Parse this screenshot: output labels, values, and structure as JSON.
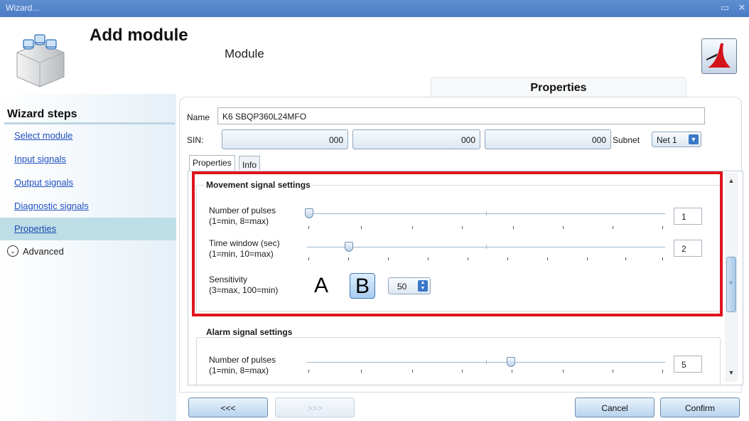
{
  "window": {
    "title": "Wizard...",
    "restore_icon": "restore-icon",
    "close_icon": "close-icon"
  },
  "header": {
    "title": "Add module",
    "subtitle": "Module",
    "app_icon": "module-blocks-icon",
    "logo_icon": "app-logo-icon"
  },
  "tabs": {
    "main": "Properties"
  },
  "sidebar": {
    "heading": "Wizard steps",
    "items": [
      {
        "label": "Select module",
        "active": false
      },
      {
        "label": "Input signals",
        "active": false
      },
      {
        "label": "Output signals",
        "active": false
      },
      {
        "label": "Diagnostic signals",
        "active": false
      },
      {
        "label": "Properties",
        "active": true
      }
    ],
    "advanced_label": "Advanced"
  },
  "form": {
    "name_label": "Name",
    "name_value": "K6 SBQP360L24MFO",
    "sin_label": "SIN:",
    "sin_values": [
      "000",
      "000",
      "000"
    ],
    "subnet_label": "Subnet",
    "subnet_value": "Net 1",
    "subtabs": [
      "Properties",
      "Info"
    ]
  },
  "movement": {
    "title": "Movement signal settings",
    "pulses_label": "Number of pulses",
    "pulses_range": "(1=min, 8=max)",
    "pulses_value": "1",
    "pulses_level": 1,
    "time_label": "Time window (sec)",
    "time_range": "(1=min, 10=max)",
    "time_value": "2",
    "time_level": 2,
    "sensitivity_label": "Sensitivity",
    "sensitivity_range": "(3=max, 100=min)",
    "option_a": "A",
    "option_b": "B",
    "selected_option": "B",
    "sensitivity_value": "50"
  },
  "alarm": {
    "title": "Alarm signal settings",
    "pulses_label": "Number of pulses",
    "pulses_range": "(1=min, 8=max)",
    "pulses_value": "5",
    "pulses_level": 5
  },
  "buttons": {
    "back": "<<<",
    "next": ">>>",
    "cancel": "Cancel",
    "confirm": "Confirm"
  },
  "colors": {
    "titlebar": "#4a7bc4",
    "highlight": "#e0141d",
    "active_step": "#bedee7",
    "link": "#1f4fbf"
  }
}
